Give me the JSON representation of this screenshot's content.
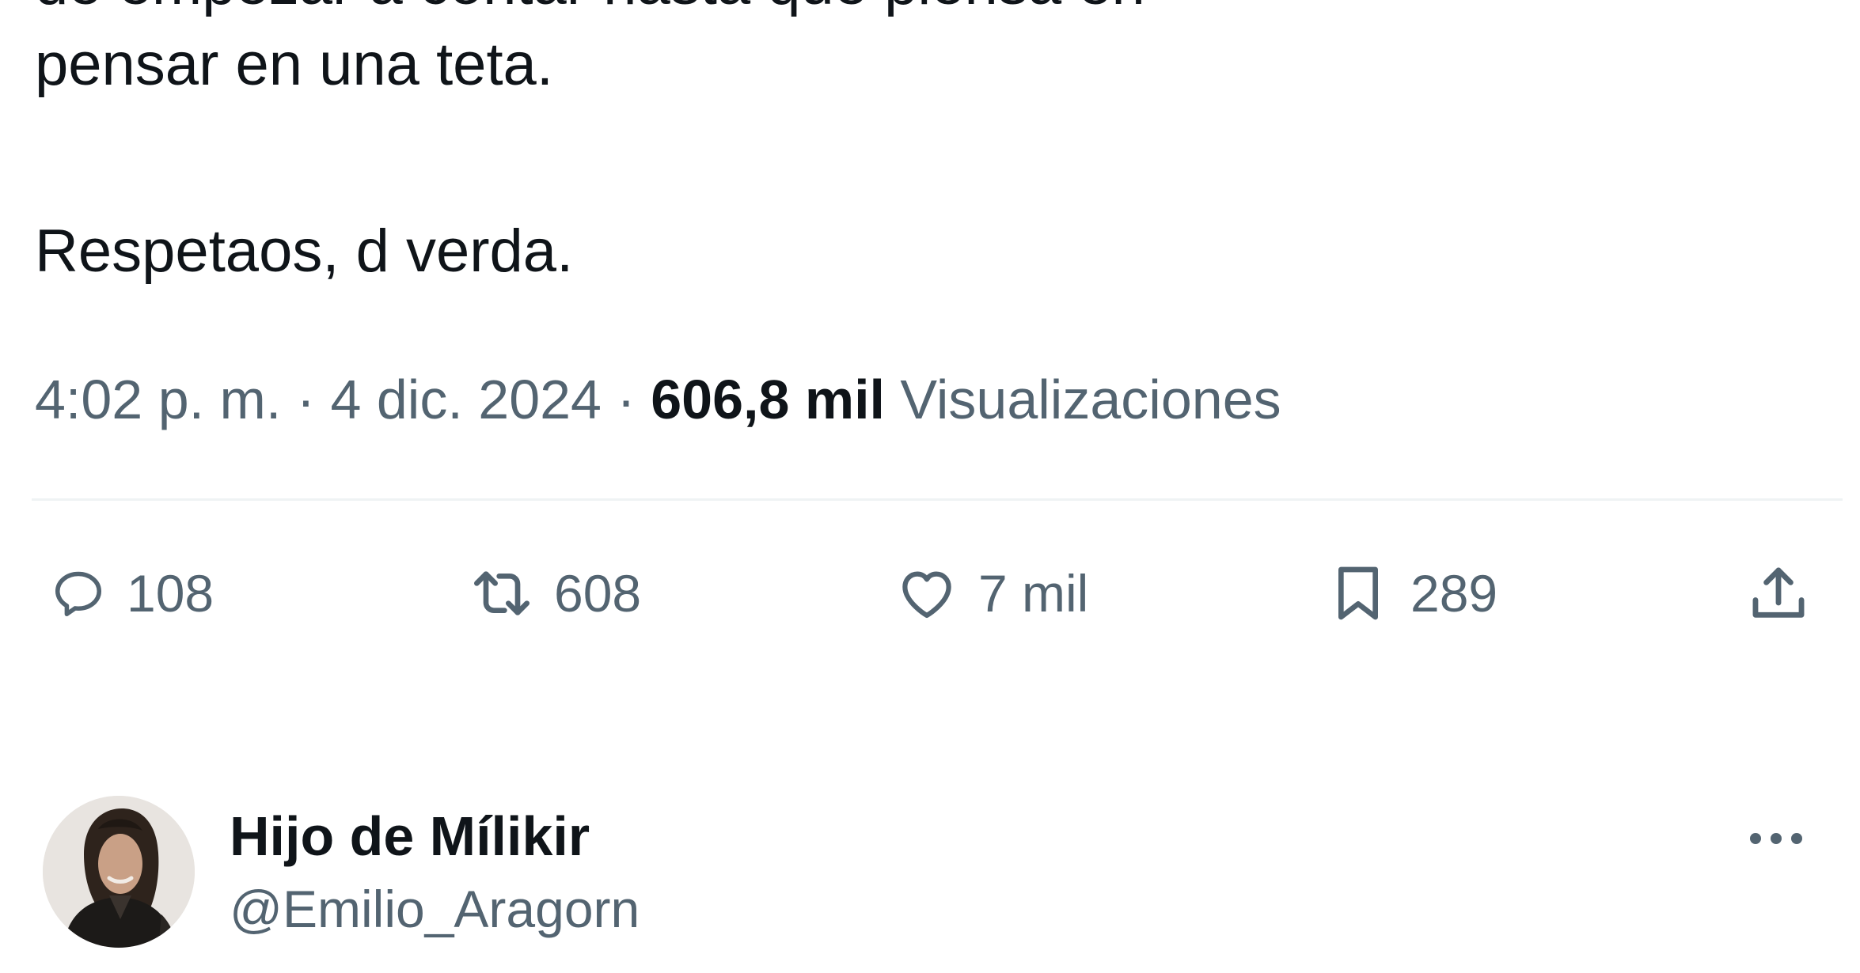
{
  "tweet": {
    "cut_text_line": "de empezar a contar hasta que piensa en",
    "lines": [
      "pensar en una teta.",
      "Respetaos, d verda."
    ]
  },
  "meta": {
    "time": "4:02 p. m.",
    "separator1": " · ",
    "date": "4 dic. 2024",
    "separator2": " · ",
    "views_count": "606,8 mil",
    "views_label": "Visualizaciones"
  },
  "actions": {
    "replies": "108",
    "retweets": "608",
    "likes": "7 mil",
    "bookmarks": "289"
  },
  "author": {
    "name": "Hijo de Mílikir",
    "handle": "@Emilio_Aragorn"
  },
  "colors": {
    "text": "#0f1419",
    "secondary": "#536471",
    "divider": "#eff3f4"
  },
  "icons": [
    "reply-icon",
    "retweet-icon",
    "like-icon",
    "bookmark-icon",
    "share-icon",
    "more-icon"
  ]
}
